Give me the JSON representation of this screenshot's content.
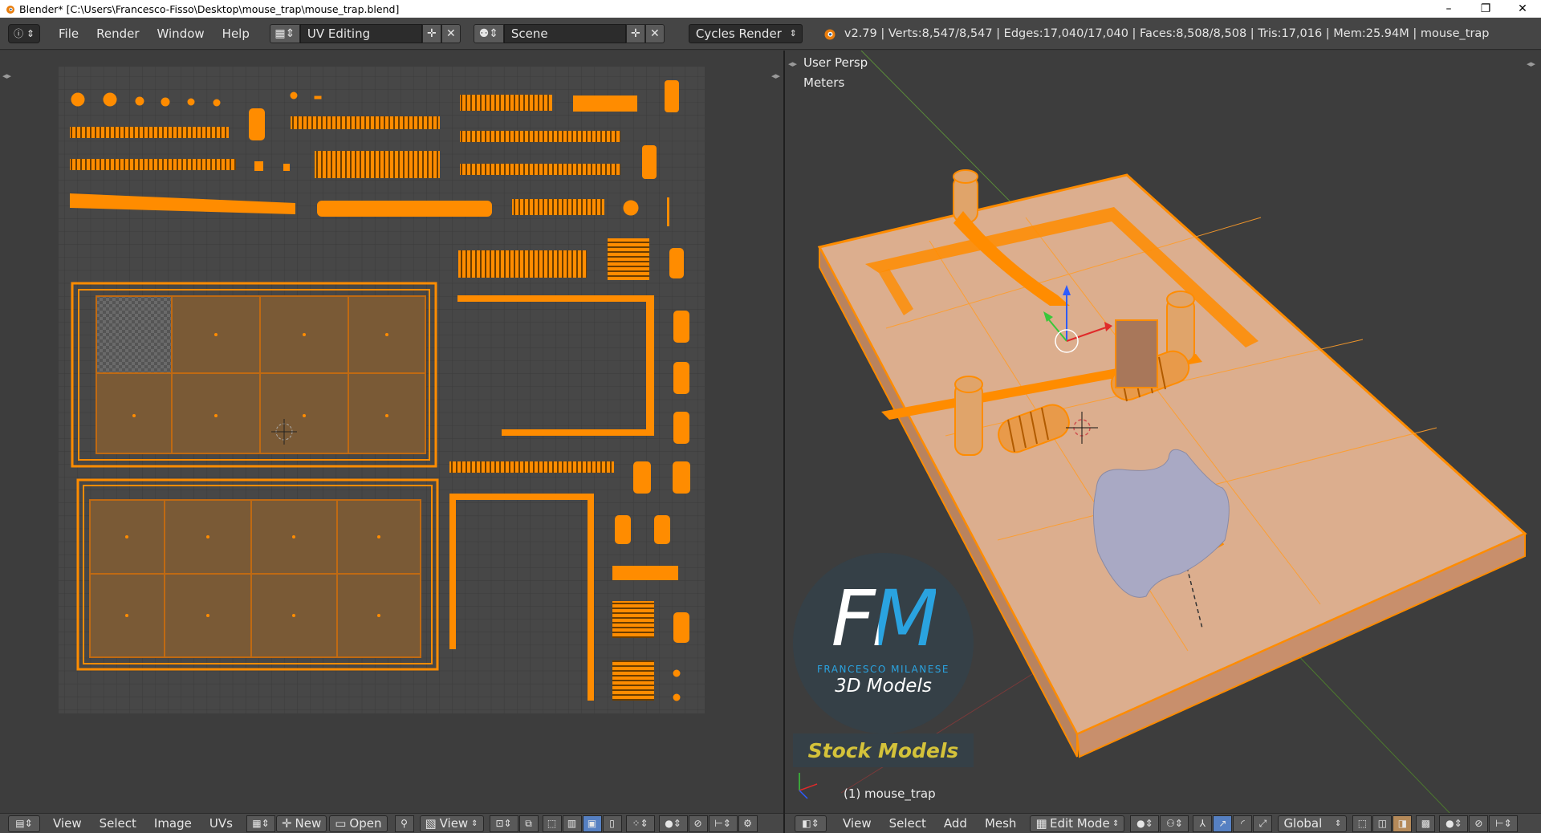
{
  "window": {
    "title": "Blender* [C:\\Users\\Francesco-Fisso\\Desktop\\mouse_trap\\mouse_trap.blend]",
    "min_glyph": "–",
    "max_glyph": "❐",
    "close_glyph": "✕"
  },
  "info_header": {
    "menus": [
      "File",
      "Render",
      "Window",
      "Help"
    ],
    "screen_layout": "UV Editing",
    "scene": "Scene",
    "render_engine": "Cycles Render",
    "stats": "v2.79 | Verts:8,547/8,547 | Edges:17,040/17,040 | Faces:8,508/8,508 | Tris:17,016 | Mem:25.94M | mouse_trap"
  },
  "uv_editor": {
    "menus": [
      "View",
      "Select",
      "Image",
      "UVs"
    ],
    "new_label": "New",
    "open_label": "Open",
    "view_label": "View"
  },
  "viewport": {
    "view_name": "User Persp",
    "units": "Meters",
    "object_label": "(1) mouse_trap",
    "menus": [
      "View",
      "Select",
      "Add",
      "Mesh"
    ],
    "mode": "Edit Mode",
    "orientation": "Global"
  },
  "watermark": {
    "logo_letters": "FM",
    "brand": "FRANCESCO MILANESE",
    "tagline": "3D Models",
    "banner": "Stock Models"
  },
  "colors": {
    "uv_orange": "#ff8c00",
    "selected_face": "#7a5a36",
    "board_face": "#d9ab8a",
    "header_bg": "#454545",
    "editor_bg": "#3d3d3d",
    "grid_bg": "#474747",
    "stock_yellow": "#d4c23a",
    "logo_blue": "#2aa3e0"
  }
}
